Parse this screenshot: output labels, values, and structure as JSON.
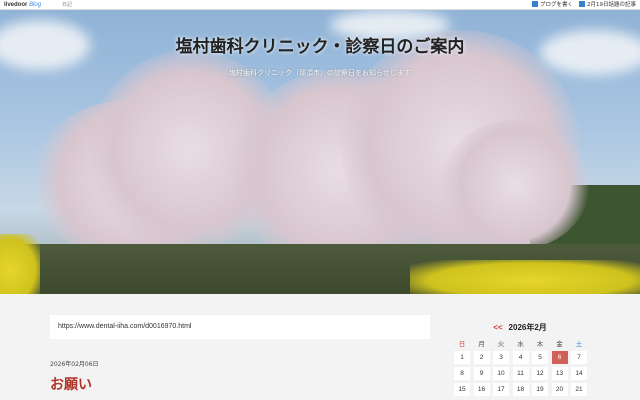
{
  "topbar": {
    "logo_main": "livedoor",
    "logo_sub": "Blog",
    "diary": "日記",
    "write_label": "ブログを書く",
    "archive_label": "2月19日話題の記事"
  },
  "header": {
    "title": "塩村歯科クリニック・診察日のご案内",
    "subtitle": "塩村歯科クリニック（那須市）の診察日をお知らせします"
  },
  "post": {
    "url": "https://www.dental-iiha.com/d0016970.html",
    "date": "2026年02月06日",
    "title": "お願い"
  },
  "calendar": {
    "prev": "<<",
    "month": "2026年2月",
    "weekdays": [
      "日",
      "月",
      "火",
      "水",
      "木",
      "金",
      "土"
    ],
    "days": [
      "1",
      "2",
      "3",
      "4",
      "5",
      "6",
      "7",
      "8",
      "9",
      "10",
      "11",
      "12",
      "13",
      "14",
      "15",
      "16",
      "17",
      "18",
      "19",
      "20",
      "21"
    ],
    "today": "6",
    "accent": "#d0605a"
  }
}
